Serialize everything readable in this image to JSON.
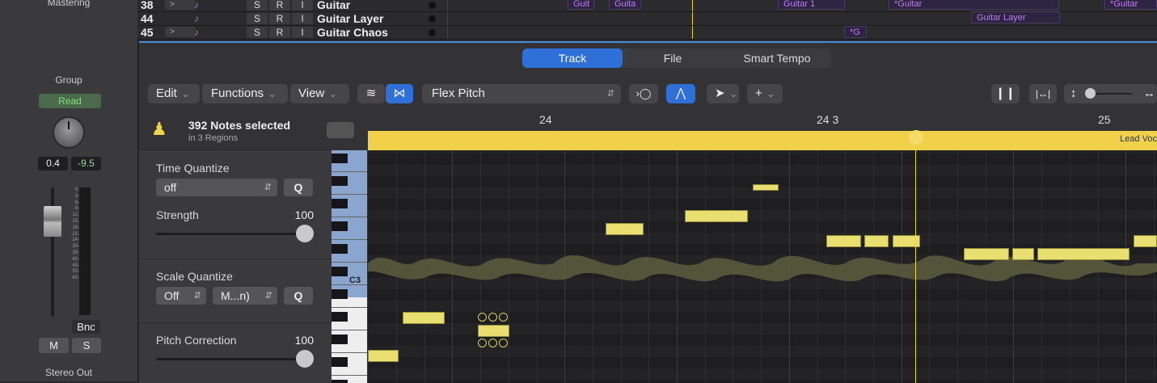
{
  "strip": {
    "top_label": "Mastering",
    "group_label": "Group",
    "automation_mode": "Read",
    "pan_value": "0.4",
    "gain_value": "-9.5",
    "meter_scale": [
      "0",
      "3",
      "6",
      "9",
      "12",
      "15",
      "18",
      "21",
      "24",
      "30",
      "35",
      "40",
      "45",
      "50",
      "60"
    ],
    "bounce_label": "Bnc",
    "mute_label": "M",
    "solo_label": "S",
    "output_label": "Stereo Out"
  },
  "tracks": [
    {
      "num": "38",
      "name": "Guitar",
      "s": "S",
      "r": "R",
      "i": "I"
    },
    {
      "num": "44",
      "name": "Guitar Layer",
      "s": "S",
      "r": "R",
      "i": "I"
    },
    {
      "num": "45",
      "name": "Guitar Chaos",
      "s": "S",
      "r": "R",
      "i": "I"
    }
  ],
  "regions": [
    {
      "label": "Guit",
      "row": 0
    },
    {
      "label": "Guita",
      "row": 0
    },
    {
      "label": "Guitar 1",
      "row": 0
    },
    {
      "label": "*Guitar",
      "row": 0
    },
    {
      "label": "*Guitar",
      "row": 0
    },
    {
      "label": "Guitar Layer",
      "row": 1
    },
    {
      "label": "*G",
      "row": 2
    }
  ],
  "editor": {
    "tabs": [
      {
        "label": "Track",
        "active": true
      },
      {
        "label": "File",
        "active": false
      },
      {
        "label": "Smart Tempo",
        "active": false
      }
    ],
    "menus": {
      "edit": "Edit",
      "functions": "Functions",
      "view": "View"
    },
    "mode_select": "Flex Pitch",
    "ruler": {
      "bar1": "24",
      "bar2": "24 3",
      "bar3": "25"
    },
    "region_name": "Lead Voc",
    "key_label": "C3",
    "accent_color": "#2f6fd8",
    "note_color": "#e8df70"
  },
  "inspector": {
    "selection_title": "392 Notes selected",
    "selection_sub": "in 3 Regions",
    "time_quantize_label": "Time Quantize",
    "time_quantize_value": "off",
    "strength_label": "Strength",
    "strength_value": "100",
    "scale_quantize_label": "Scale Quantize",
    "scale_quantize_mode": "Off",
    "scale_quantize_scale": "M...n)",
    "q_label": "Q",
    "pitch_correction_label": "Pitch Correction",
    "pitch_correction_value": "100"
  }
}
